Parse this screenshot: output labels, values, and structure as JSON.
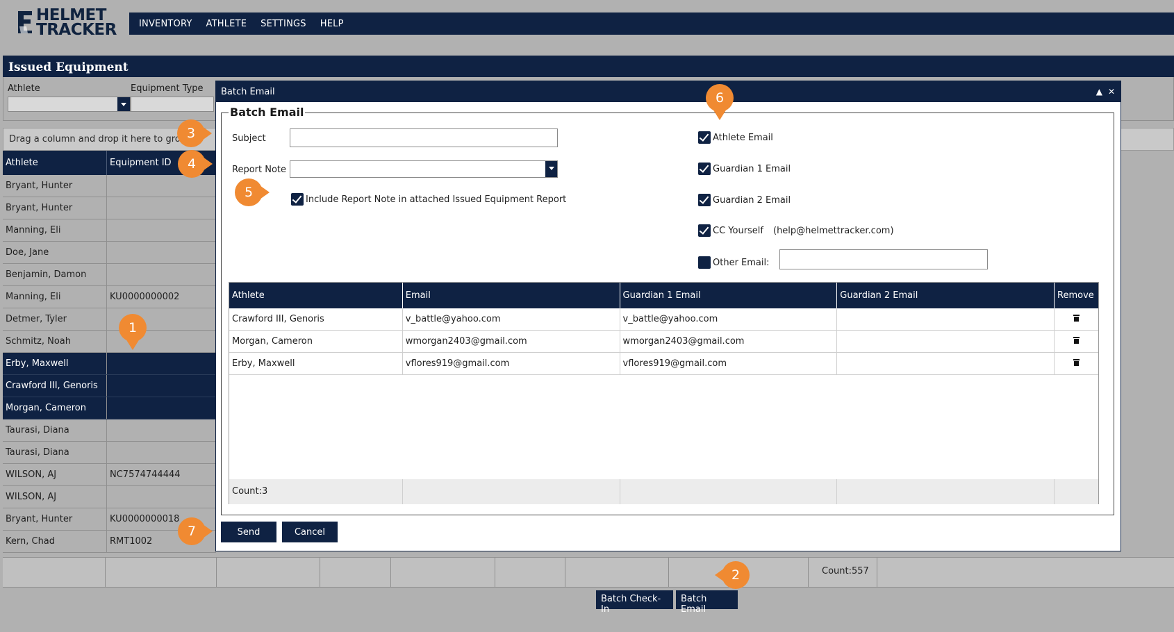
{
  "brand": {
    "line1": "HELMET",
    "line2": "TRACKER"
  },
  "nav": {
    "items": [
      "INVENTORY",
      "ATHLETE",
      "SETTINGS",
      "HELP"
    ]
  },
  "panel": {
    "title": "Issued Equipment",
    "filters": {
      "athlete_label": "Athlete",
      "equipment_type_label": "Equipment Type"
    },
    "group_hint": "Drag a column and drop it here to gro",
    "columns": [
      "Athlete",
      "Equipment ID"
    ],
    "rows": [
      {
        "athlete": "Bryant, Hunter",
        "equipment_id": ""
      },
      {
        "athlete": "Bryant, Hunter",
        "equipment_id": ""
      },
      {
        "athlete": "Manning, Eli",
        "equipment_id": ""
      },
      {
        "athlete": "Doe, Jane",
        "equipment_id": ""
      },
      {
        "athlete": "Benjamin, Damon",
        "equipment_id": ""
      },
      {
        "athlete": "Manning, Eli",
        "equipment_id": "KU0000000002"
      },
      {
        "athlete": "Detmer, Tyler",
        "equipment_id": ""
      },
      {
        "athlete": "Schmitz, Noah",
        "equipment_id": ""
      },
      {
        "athlete": "Erby, Maxwell",
        "equipment_id": "",
        "selected": true
      },
      {
        "athlete": "Crawford III, Genoris",
        "equipment_id": "",
        "selected": true
      },
      {
        "athlete": "Morgan, Cameron",
        "equipment_id": "",
        "selected": true
      },
      {
        "athlete": "Taurasi, Diana",
        "equipment_id": ""
      },
      {
        "athlete": "Taurasi, Diana",
        "equipment_id": ""
      },
      {
        "athlete": "WILSON, AJ",
        "equipment_id": "NC7574744444"
      },
      {
        "athlete": "WILSON, AJ",
        "equipment_id": ""
      },
      {
        "athlete": "Bryant, Hunter",
        "equipment_id": "KU0000000018"
      },
      {
        "athlete": "Kern, Chad",
        "equipment_id": "RMT1002"
      }
    ],
    "count": "Count:557",
    "batch_checkin": "Batch Check-In",
    "batch_email": "Batch Email"
  },
  "modal": {
    "title": "Batch Email",
    "legend": "Batch Email",
    "subject_label": "Subject",
    "subject_value": "",
    "report_note_label": "Report Note",
    "report_note_value": "",
    "include_note_label": "Include Report Note in attached Issued Equipment Report",
    "include_note_checked": true,
    "athlete_email_label": "Athlete Email",
    "guardian1_label": "Guardian 1 Email",
    "guardian2_label": "Guardian 2 Email",
    "cc_label": "CC Yourself",
    "cc_address": "(help@helmettracker.com)",
    "other_label": "Other Email:",
    "other_value": "",
    "table": {
      "columns": [
        "Athlete",
        "Email",
        "Guardian 1 Email",
        "Guardian 2 Email",
        "Remove"
      ],
      "rows": [
        {
          "athlete": "Crawford III, Genoris",
          "email": "v_battle@yahoo.com",
          "g1": "v_battle@yahoo.com",
          "g2": ""
        },
        {
          "athlete": "Morgan, Cameron",
          "email": "wmorgan2403@gmail.com",
          "g1": "wmorgan2403@gmail.com",
          "g2": ""
        },
        {
          "athlete": "Erby, Maxwell",
          "email": "vflores919@gmail.com",
          "g1": "vflores919@gmail.com",
          "g2": ""
        }
      ],
      "count": "Count:3"
    },
    "send": "Send",
    "cancel": "Cancel"
  },
  "callouts": [
    "1",
    "2",
    "3",
    "4",
    "5",
    "6",
    "7"
  ],
  "colors": {
    "navy": "#0f2243",
    "accent": "#f08a32",
    "background": "#b1b1b1"
  },
  "icons": {
    "close": "close-icon",
    "collapse": "collapse-icon",
    "trash": "trash-icon"
  }
}
